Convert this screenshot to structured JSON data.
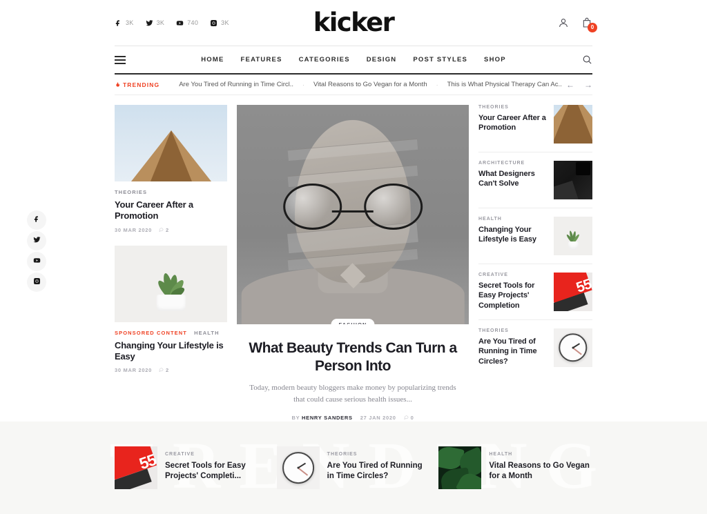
{
  "brand": {
    "name": "kicker"
  },
  "topbar": {
    "socials": [
      {
        "icon": "facebook-icon",
        "name": "facebook",
        "count": "3K"
      },
      {
        "icon": "twitter-icon",
        "name": "twitter",
        "count": "3K"
      },
      {
        "icon": "youtube-icon",
        "name": "youtube",
        "count": "740"
      },
      {
        "icon": "instagram-icon",
        "name": "instagram",
        "count": "3K"
      }
    ],
    "account_icon": "user-icon",
    "cart_icon": "cart-icon",
    "cart_count": "0"
  },
  "nav": {
    "menu_icon": "hamburger-icon",
    "search_icon": "search-icon",
    "links": [
      {
        "label": "HOME"
      },
      {
        "label": "FEATURES"
      },
      {
        "label": "CATEGORIES"
      },
      {
        "label": "DESIGN"
      },
      {
        "label": "POST STYLES"
      },
      {
        "label": "SHOP"
      }
    ]
  },
  "trending_bar": {
    "label": "TRENDING",
    "icon": "flame-icon",
    "items": [
      {
        "title": "Are You Tired of Running in Time Circl.."
      },
      {
        "title": "Vital Reasons to Go Vegan for a Month"
      },
      {
        "title": "This is What Physical Therapy Can Ac.."
      }
    ],
    "prev_arrow": "←",
    "next_arrow": "→"
  },
  "social_rail": [
    {
      "icon": "facebook-icon",
      "name": "facebook"
    },
    {
      "icon": "twitter-icon",
      "name": "twitter"
    },
    {
      "icon": "youtube-icon",
      "name": "youtube"
    },
    {
      "icon": "instagram-icon",
      "name": "instagram"
    }
  ],
  "left_column": [
    {
      "category": "THEORIES",
      "sponsored": "",
      "title": "Your Career After a Promotion",
      "date": "30 MAR 2020",
      "comments": "2",
      "image": "roof-photo"
    },
    {
      "category": "HEALTH",
      "sponsored": "SPONSORED CONTENT",
      "title": "Changing Your Lifestyle is Easy",
      "date": "30 MAR 2020",
      "comments": "2",
      "image": "plant-photo"
    }
  ],
  "feature": {
    "badge": "FASHION",
    "title": "What Beauty Trends Can Turn a Person Into",
    "excerpt": "Today, modern beauty bloggers make money by popularizing trends that could cause serious health issues...",
    "by_label": "BY",
    "author": "HENRY SANDERS",
    "date": "27 JAN 2020",
    "comments": "0",
    "image": "portrait-photo"
  },
  "right_column": [
    {
      "category": "THEORIES",
      "title": "Your Career After a Promotion",
      "image": "roof-photo"
    },
    {
      "category": "ARCHITECTURE",
      "title": "What Designers Can't Solve",
      "image": "dark-photo"
    },
    {
      "category": "HEALTH",
      "title": "Changing Your Lifestyle is Easy",
      "image": "plant-photo"
    },
    {
      "category": "CREATIVE",
      "title": "Secret Tools for Easy Projects' Completion",
      "image": "laptop-photo"
    },
    {
      "category": "THEORIES",
      "title": "Are You Tired of Running in Time Circles?",
      "image": "clock-photo"
    }
  ],
  "trending_section": {
    "watermark": "TRENDING",
    "items": [
      {
        "category": "CREATIVE",
        "title": "Secret Tools for Easy Projects' Completi...",
        "image": "laptop-photo"
      },
      {
        "category": "THEORIES",
        "title": "Are You Tired of Running in Time Circles?",
        "image": "clock-photo"
      },
      {
        "category": "HEALTH",
        "title": "Vital Reasons to Go Vegan for a Month",
        "image": "leaves-photo"
      }
    ]
  },
  "colors": {
    "accent": "#ef4123",
    "text": "#1d1d24",
    "muted": "#9a9aa2",
    "section_bg": "#f7f7f5"
  }
}
